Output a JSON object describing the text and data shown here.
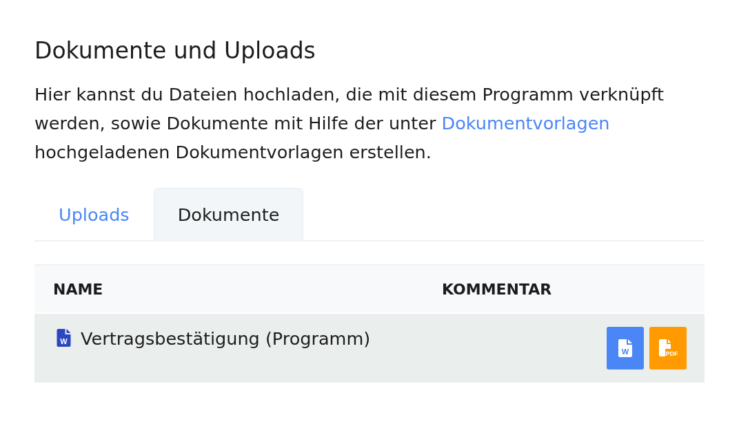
{
  "section": {
    "title": "Dokumente und Uploads",
    "description": [
      {
        "kind": "text",
        "text": "Hier kannst du Dateien hochladen, die mit diesem Programm verknüpft werden, sowie Dokumente mit Hilfe der unter "
      },
      {
        "kind": "link",
        "text": "Dokumentvorlagen"
      },
      {
        "kind": "text",
        "text": " hochgeladenen Dokumentvorlagen erstellen."
      }
    ]
  },
  "tabs": [
    {
      "label": "Uploads",
      "selected": false
    },
    {
      "label": "Dokumente",
      "selected": true
    }
  ],
  "table": {
    "columns": [
      "NAME",
      "KOMMENTAR"
    ],
    "rows": [
      {
        "name": "Vertragsbestätigung (Programm)",
        "file_icon_mark": "W",
        "actions": [
          {
            "kind": "word",
            "mark": "W"
          },
          {
            "kind": "pdf",
            "mark": "PDF"
          }
        ]
      }
    ]
  }
}
